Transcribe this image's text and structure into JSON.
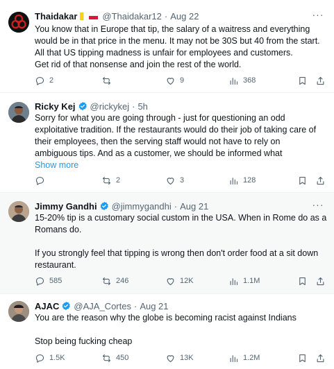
{
  "tweets": [
    {
      "name": "Thaidakar",
      "handle": "@Thaidakar12",
      "sep": "·",
      "time": "Aug 22",
      "avatar_icon": "biohazard-icon",
      "lines": [
        "You know that in Europe that tip, the salary of a waitress and everything",
        "would be in that price in the menu. It may not be 30S but 40 from the start.",
        "All that US tipping madness is unfair for employees and customers.",
        "Get rid of that nonsense and join the rest of the world."
      ],
      "replies": "2",
      "retweets": "",
      "likes": "9",
      "views": "368"
    },
    {
      "name": "Ricky Kej",
      "handle": "@rickykej",
      "sep": "·",
      "time": "5h",
      "verified": true,
      "lines": [
        "Sorry for what you are going through - just for questioning an odd",
        "exploitative tradition. If the restaurants would do their job of taking care of",
        "their employees, then the serving staff would not have to rely on",
        "ambiguous tips. And as a customer, we should be informed what"
      ],
      "show_more": "Show more",
      "replies": "",
      "retweets": "2",
      "likes": "3",
      "views": "128"
    },
    {
      "name": "Jimmy Gandhi",
      "handle": "@jimmygandhi",
      "sep": "·",
      "time": "Aug 21",
      "verified": true,
      "lines": [
        "15-20% tip is a customary social custom in the USA. When in Rome do as a",
        "Romans do.",
        "",
        "If you strongly feel that tipping is wrong then don't order food at a sit down",
        "restaurant."
      ],
      "replies": "585",
      "retweets": "246",
      "likes": "12K",
      "views": "1.1M"
    },
    {
      "name": "AJAC",
      "handle": "@AJA_Cortes",
      "sep": "·",
      "time": "Aug 21",
      "verified": true,
      "lines": [
        "You are the reason why the globe is becoming racist against Indians",
        "",
        "Stop being fucking cheap"
      ],
      "replies": "1.5K",
      "retweets": "450",
      "likes": "13K",
      "views": "1.2M"
    }
  ],
  "colors": {
    "text": "#0f1419",
    "secondary": "#536471",
    "link": "#1d9bf0",
    "verified": "#1d9bf0",
    "hover_bg": "#f7f9f9",
    "divider": "#eff3f4"
  }
}
